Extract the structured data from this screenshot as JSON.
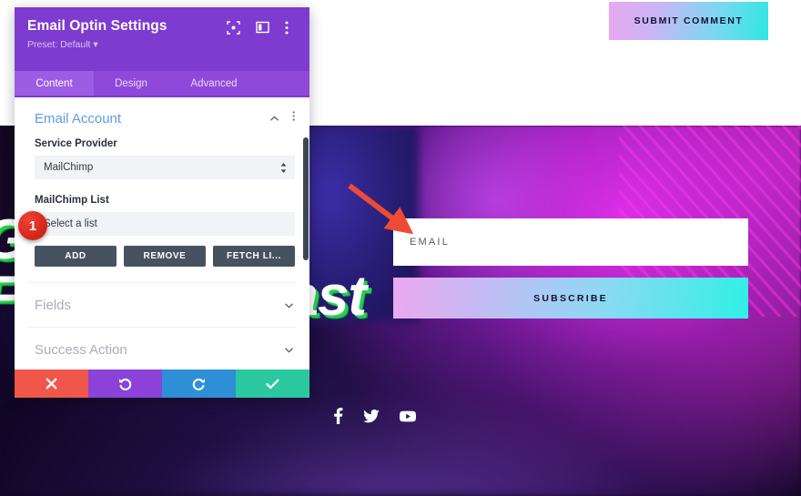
{
  "page": {
    "submit_comment_label": "SUBMIT COMMENT",
    "headline_line1": "Grow Your",
    "headline_line2": "Following Fast",
    "optin": {
      "email_placeholder": "EMAIL",
      "subscribe_label": "SUBSCRIBE"
    },
    "socials": [
      {
        "name": "facebook-icon",
        "label": "Facebook"
      },
      {
        "name": "twitter-icon",
        "label": "Twitter"
      },
      {
        "name": "youtube-icon",
        "label": "YouTube"
      }
    ]
  },
  "annotation": {
    "arrow_color": "#ee4b34",
    "badge_number": "1",
    "badge_color": "#d8281c"
  },
  "modal": {
    "title": "Email Optin Settings",
    "preset": "Preset: Default",
    "header_icons": [
      {
        "name": "focus-icon"
      },
      {
        "name": "layout-panel-icon"
      },
      {
        "name": "kebab-menu-icon"
      }
    ],
    "tabs": [
      {
        "label": "Content",
        "active": true
      },
      {
        "label": "Design",
        "active": false
      },
      {
        "label": "Advanced",
        "active": false
      }
    ],
    "sections": [
      {
        "title": "Email Account",
        "expanded": true
      },
      {
        "title": "Fields",
        "expanded": false
      },
      {
        "title": "Success Action",
        "expanded": false
      }
    ],
    "email_account": {
      "service_provider_label": "Service Provider",
      "service_provider_value": "MailChimp",
      "list_label": "MailChimp List",
      "list_value": "Select a list",
      "buttons": [
        {
          "label": "ADD",
          "name": "add-button"
        },
        {
          "label": "REMOVE",
          "name": "remove-button"
        },
        {
          "label": "FETCH LI...",
          "name": "fetch-lists-button"
        }
      ]
    },
    "footer_buttons": [
      {
        "name": "close-button",
        "icon": "x-icon",
        "color": "#f0564a"
      },
      {
        "name": "undo-button",
        "icon": "undo-icon",
        "color": "#8b42d8"
      },
      {
        "name": "redo-button",
        "icon": "redo-icon",
        "color": "#2e8fd6"
      },
      {
        "name": "save-button",
        "icon": "check-icon",
        "color": "#2bc8a0"
      }
    ]
  },
  "colors": {
    "modal_header": "#7e3bd0",
    "tab_bar": "#8e49da",
    "tab_active": "#9d5ce4",
    "section_title": "#5a9fe0",
    "dark_button": "#475261"
  }
}
